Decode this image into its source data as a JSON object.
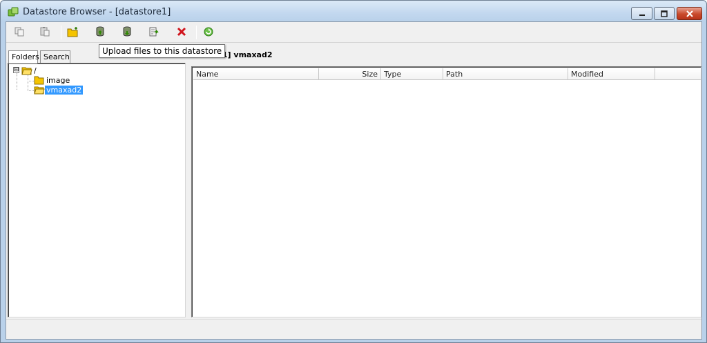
{
  "window": {
    "title": "Datastore Browser - [datastore1]"
  },
  "toolbar": {
    "buttons": [
      {
        "name": "copy-button",
        "icon": "copy-icon",
        "tooltip": ""
      },
      {
        "name": "paste-button",
        "icon": "paste-icon",
        "tooltip": ""
      },
      {
        "name": "new-folder-button",
        "icon": "new-folder-icon",
        "tooltip": ""
      },
      {
        "name": "upload-button",
        "icon": "upload-datastore-icon",
        "tooltip": "Upload files to this datastore"
      },
      {
        "name": "download-button",
        "icon": "download-datastore-icon",
        "tooltip": ""
      },
      {
        "name": "register-vm-button",
        "icon": "register-vm-icon",
        "tooltip": ""
      },
      {
        "name": "delete-button",
        "icon": "delete-icon",
        "tooltip": ""
      },
      {
        "name": "refresh-button",
        "icon": "refresh-icon",
        "tooltip": ""
      }
    ]
  },
  "tooltip": {
    "text": "Upload files to this datastore"
  },
  "tabs": [
    {
      "label": "Folders",
      "active": true
    },
    {
      "label": "Search",
      "active": false
    }
  ],
  "path_label": "re1] vmaxad2",
  "tree": {
    "root": {
      "label": "/",
      "expander": "⊟"
    },
    "children": [
      {
        "label": "image",
        "selected": false
      },
      {
        "label": "vmaxad2",
        "selected": true
      }
    ]
  },
  "table": {
    "columns": [
      "Name",
      "Size",
      "Type",
      "Path",
      "Modified"
    ],
    "rows": []
  },
  "colors": {
    "selection": "#3399ff",
    "delete_red": "#d0141c",
    "folder_yellow": "#f5c400"
  }
}
